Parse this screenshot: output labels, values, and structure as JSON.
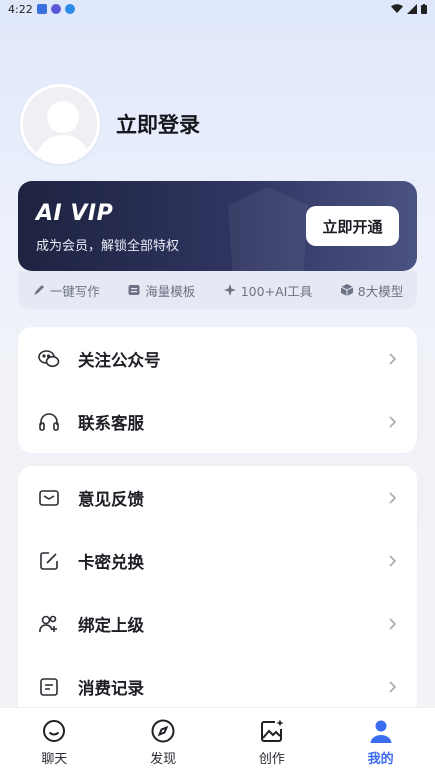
{
  "status_bar": {
    "time": "4:22"
  },
  "profile": {
    "login_label": "立即登录"
  },
  "vip": {
    "title": "AI VIP",
    "subtitle": "成为会员，解锁全部特权",
    "button_label": "立即开通"
  },
  "features": [
    {
      "icon": "pen-icon",
      "label": "一键写作"
    },
    {
      "icon": "template-icon",
      "label": "海量模板"
    },
    {
      "icon": "sparkle-icon",
      "label": "100+AI工具"
    },
    {
      "icon": "cube-icon",
      "label": "8大模型"
    }
  ],
  "menu_group_1": [
    {
      "icon": "wechat-icon",
      "label": "关注公众号"
    },
    {
      "icon": "headset-icon",
      "label": "联系客服"
    }
  ],
  "menu_group_2": [
    {
      "icon": "mail-icon",
      "label": "意见反馈"
    },
    {
      "icon": "edit-icon",
      "label": "卡密兑换"
    },
    {
      "icon": "users-icon",
      "label": "绑定上级"
    },
    {
      "icon": "document-icon",
      "label": "消费记录"
    }
  ],
  "tabs": [
    {
      "icon": "chat-icon",
      "label": "聊天"
    },
    {
      "icon": "compass-icon",
      "label": "发现"
    },
    {
      "icon": "image-create-icon",
      "label": "创作"
    },
    {
      "icon": "user-icon",
      "label": "我的",
      "active": true
    }
  ],
  "colors": {
    "accent": "#3c6df0",
    "vip_dark": "#1e2340"
  }
}
